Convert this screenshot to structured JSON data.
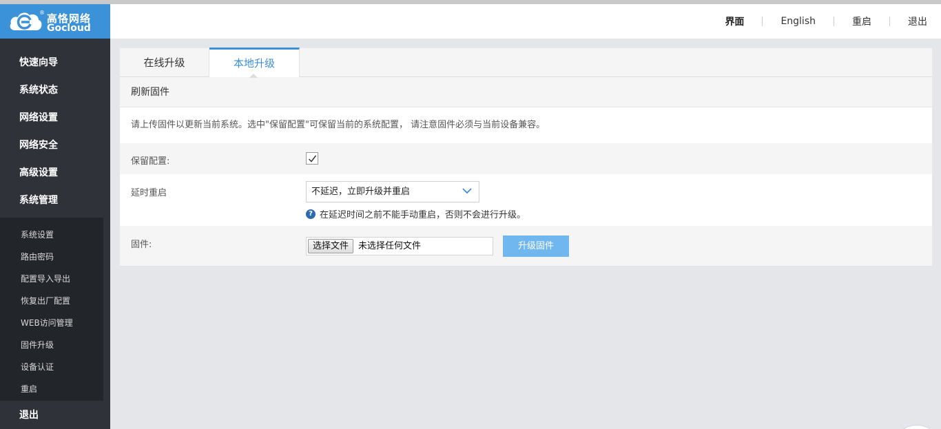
{
  "brand": {
    "name_cn": "高恪网络",
    "name_en": "Gocloud",
    "registered": "®",
    "color": "#3c92d9"
  },
  "topnav": [
    "界面",
    "English",
    "重启",
    "退出"
  ],
  "sidebar": {
    "items": [
      "快速向导",
      "系统状态",
      "网络设置",
      "网络安全",
      "高级设置",
      "系统管理"
    ],
    "submenu": [
      "系统设置",
      "路由密码",
      "配置导入导出",
      "恢复出厂配置",
      "WEB访问管理",
      "固件升级",
      "设备认证",
      "重启"
    ],
    "logout": "退出"
  },
  "tabs": {
    "online": "在线升级",
    "local": "本地升级"
  },
  "section": {
    "title": "刷新固件",
    "notice": "请上传固件以更新当前系统。选中\"保留配置\"可保留当前的系统配置， 请注意固件必须与当前设备兼容。"
  },
  "form": {
    "keep_label": "保留配置:",
    "keep_checked": true,
    "delay_label": "延时重启",
    "delay_value": "不延迟，立即升级并重启",
    "delay_hint": "在延迟时间之前不能手动重启，否则不会进行升级。",
    "hint_icon": "?",
    "firmware_label": "固件:",
    "file_button": "选择文件",
    "file_status": "未选择任何文件",
    "upgrade_button": "升级固件"
  },
  "colors": {
    "accent": "#3c92d9",
    "sidebar_bg": "#2f3238",
    "submenu_bg": "#22252a",
    "button": "#6fb7ee"
  }
}
